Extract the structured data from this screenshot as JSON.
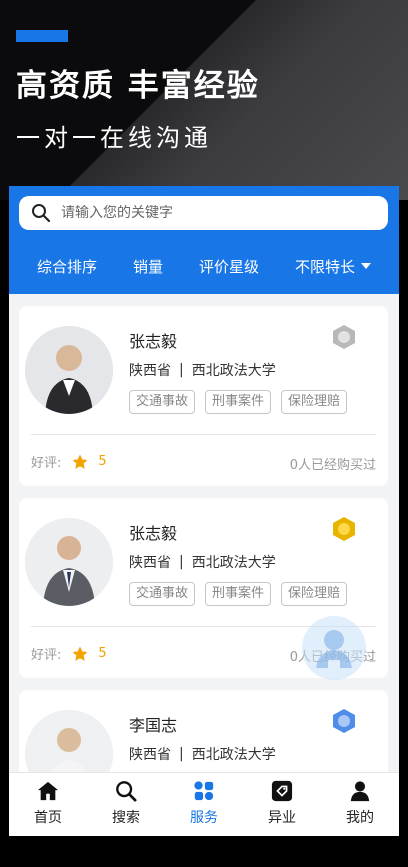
{
  "promo": {
    "title": "高资质 丰富经验",
    "subtitle": "一对一在线沟通",
    "accent_color": "#1976e6"
  },
  "search": {
    "placeholder": "请输入您的关键字",
    "icon": "search-icon"
  },
  "filters": [
    "综合排序",
    "销量",
    "评价星级",
    "不限特长"
  ],
  "lawyers": [
    {
      "name": "张志毅",
      "province": "陕西省",
      "school": "西北政法大学",
      "tags": [
        "交通事故",
        "刑事案件",
        "保险理赔"
      ],
      "rating_label": "好评:",
      "rating": "5",
      "sold": "0人已经购买过",
      "badge": "silver-badge-icon"
    },
    {
      "name": "张志毅",
      "province": "陕西省",
      "school": "西北政法大学",
      "tags": [
        "交通事故",
        "刑事案件",
        "保险理赔"
      ],
      "rating_label": "好评:",
      "rating": "5",
      "sold": "0人已经购买过",
      "badge": "gold-badge-icon"
    },
    {
      "name": "李国志",
      "province": "陕西省",
      "school": "西北政法大学",
      "tags": [],
      "badge": "blue-badge-icon"
    }
  ],
  "tabs": [
    {
      "label": "首页",
      "icon": "home-icon"
    },
    {
      "label": "搜索",
      "icon": "search-icon"
    },
    {
      "label": "服务",
      "icon": "services-icon",
      "active": true
    },
    {
      "label": "异业",
      "icon": "tag-icon"
    },
    {
      "label": "我的",
      "icon": "user-icon"
    }
  ],
  "colors": {
    "primary": "#1976e6",
    "rating": "#f0a100",
    "background": "#f2f3f5"
  }
}
